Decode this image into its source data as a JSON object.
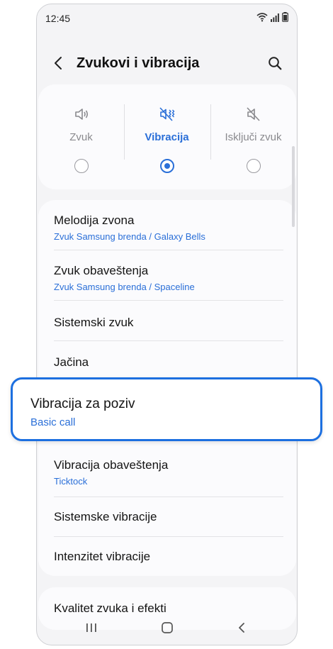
{
  "status_bar": {
    "time": "12:45",
    "icons": [
      "wifi-icon",
      "signal-icon",
      "battery-icon"
    ]
  },
  "app_bar": {
    "title": "Zvukovi i vibracija",
    "back_icon": "back-icon",
    "search_icon": "search-icon"
  },
  "sound_modes": [
    {
      "label": "Zvuk",
      "icon": "speaker-icon",
      "selected": false
    },
    {
      "label": "Vibracija",
      "icon": "vibrate-icon",
      "selected": true
    },
    {
      "label": "Isključi zvuk",
      "icon": "mute-icon",
      "selected": false
    }
  ],
  "settings_list": [
    {
      "title": "Melodija zvona",
      "subtitle": "Zvuk Samsung brenda / Galaxy Bells"
    },
    {
      "title": "Zvuk obaveštenja",
      "subtitle": "Zvuk Samsung brenda / Spaceline"
    },
    {
      "title": "Sistemski zvuk"
    },
    {
      "title": "Jačina"
    },
    {
      "title": "Vibracija za poziv",
      "subtitle": "Basic call"
    },
    {
      "title": "Vibracija obaveštenja",
      "subtitle": "Ticktock"
    },
    {
      "title": "Sistemske vibracije"
    },
    {
      "title": "Intenzitet vibracije"
    }
  ],
  "quality_list": [
    {
      "title": "Kvalitet zvuka i efekti"
    }
  ],
  "nav_bar": [
    "recents-icon",
    "home-icon",
    "back-nav-icon"
  ],
  "colors": {
    "accent": "#2a6fd8",
    "highlight_border": "#1c6fe0",
    "background": "#f4f4f6",
    "card": "#fbfbfd"
  }
}
